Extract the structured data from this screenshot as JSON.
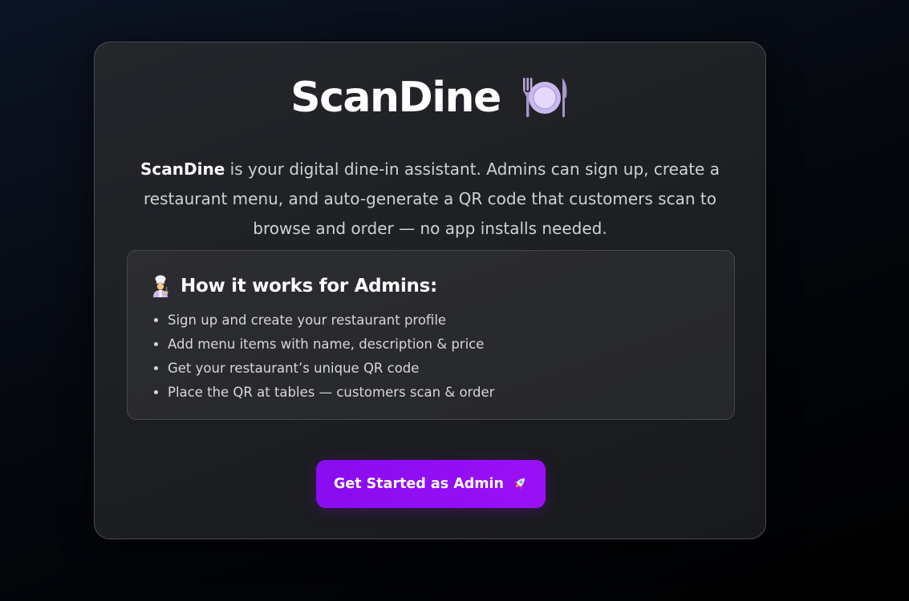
{
  "hero": {
    "title": "ScanDine",
    "title_icon": "fork-plate-knife-icon",
    "intro_brand": "ScanDine",
    "intro_text": " is your digital dine-in assistant. Admins can sign up, create a restaurant menu, and auto-generate a QR code that customers scan to browse and order — no app installs needed."
  },
  "how_it_works": {
    "icon": "chef-icon",
    "heading": "How it works for Admins:",
    "steps": [
      "Sign up and create your restaurant profile",
      "Add menu items with name, description & price",
      "Get your restaurant’s unique QR code",
      "Place the QR at tables — customers scan & order"
    ]
  },
  "cta": {
    "label": "Get Started as Admin",
    "icon": "rocket-icon"
  },
  "colors": {
    "accent": "#9b10f5",
    "card_bg": "#1f2125",
    "page_bg": "#05080f"
  }
}
